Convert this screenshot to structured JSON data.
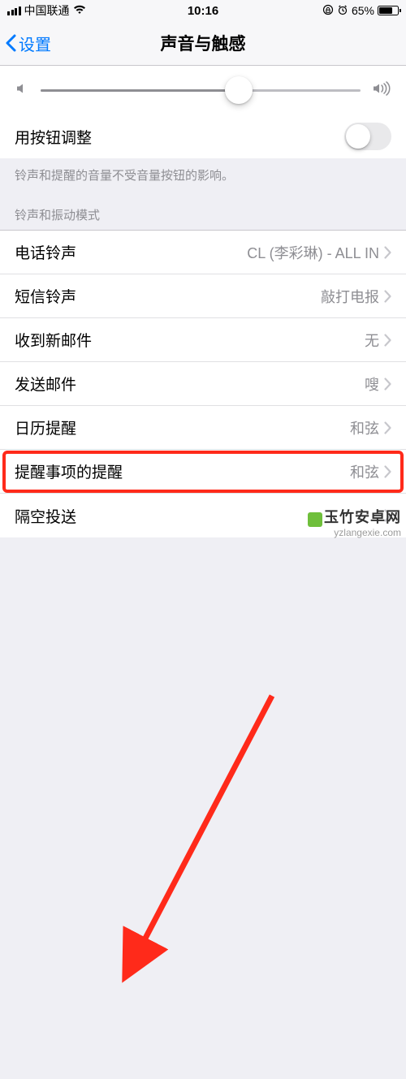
{
  "status": {
    "carrier": "中国联通",
    "time": "10:16",
    "battery_pct": "65%"
  },
  "nav": {
    "back": "设置",
    "title": "声音与触感"
  },
  "volume": {
    "slider_position_pct": 62,
    "change_with_buttons_label": "用按钮调整",
    "change_with_buttons_on": false,
    "footer": "铃声和提醒的音量不受音量按钮的影响。"
  },
  "section_header": "铃声和振动模式",
  "rows": [
    {
      "label": "电话铃声",
      "value": "CL (李彩琳) - ALL IN"
    },
    {
      "label": "短信铃声",
      "value": "敲打电报"
    },
    {
      "label": "收到新邮件",
      "value": "无"
    },
    {
      "label": "发送邮件",
      "value": "嗖"
    },
    {
      "label": "日历提醒",
      "value": "和弦"
    },
    {
      "label": "提醒事项的提醒",
      "value": "和弦"
    },
    {
      "label": "隔空投送",
      "value": ""
    }
  ],
  "highlight_row_index": 5,
  "watermark": {
    "title": "玉竹安卓网",
    "url": "yzlangexie.com"
  }
}
